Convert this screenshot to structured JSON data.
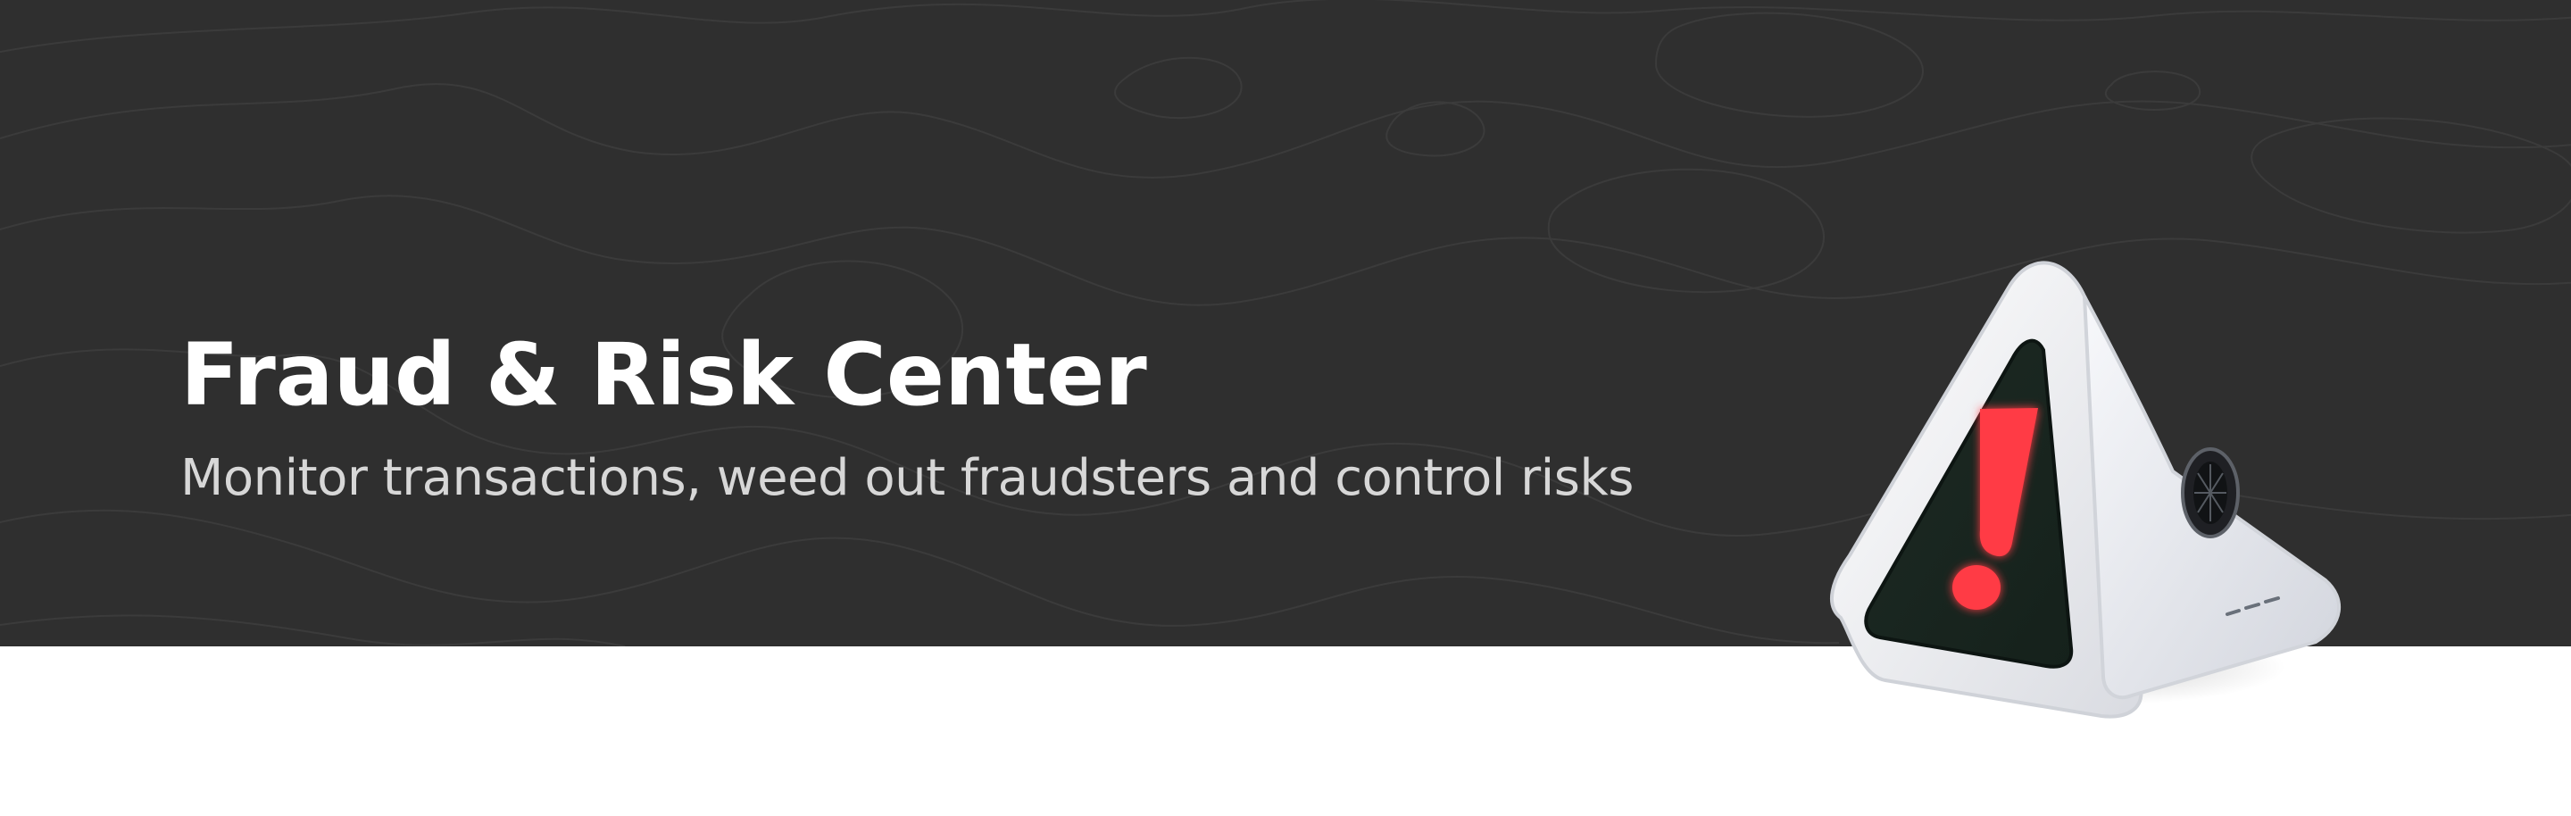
{
  "hero": {
    "title": "Fraud & Risk Center",
    "subtitle": "Monitor transactions, weed out fraudsters and control risks",
    "background_color": "#2f2f2f",
    "title_color": "#ffffff",
    "subtitle_color": "#d7d7d7"
  },
  "illustration": {
    "icon": "warning-triangle-icon",
    "alert_color": "#ff3b45"
  },
  "page": {
    "background_color": "#ffffff"
  }
}
